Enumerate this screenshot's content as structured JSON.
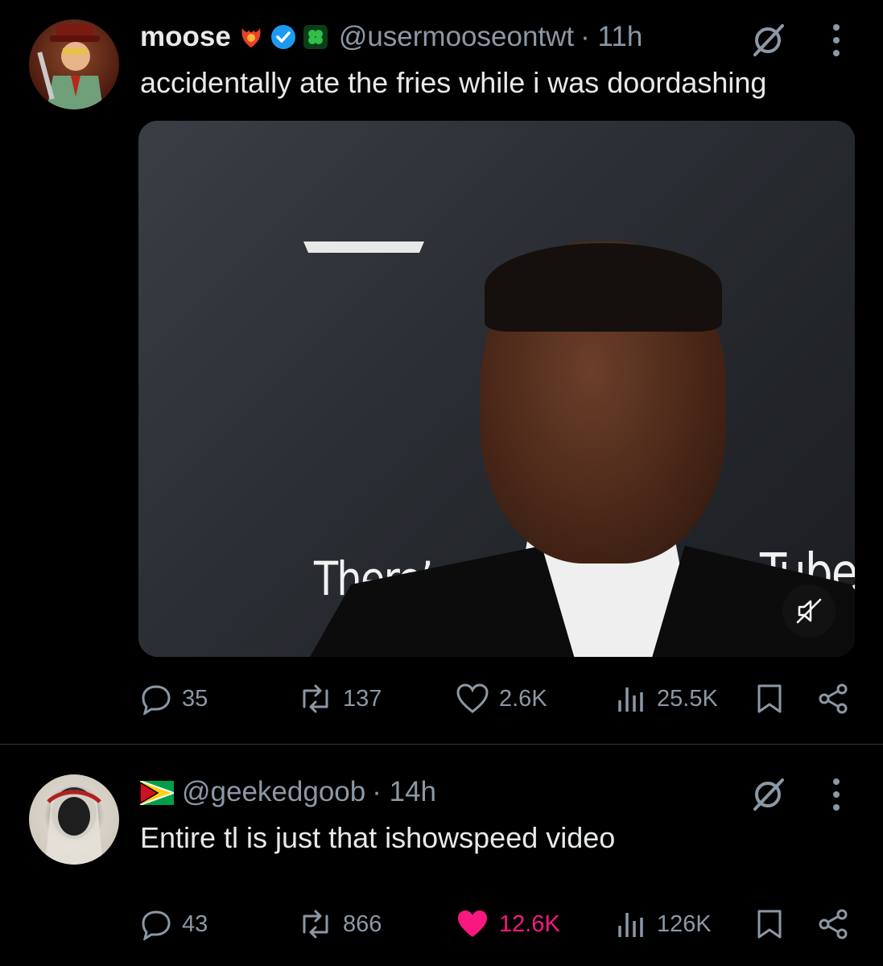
{
  "colors": {
    "background": "#000000",
    "text": "#e7e9ea",
    "muted": "#8b98a5",
    "verified": "#1d9bf0",
    "liked": "#f91880"
  },
  "post1": {
    "name": "moose",
    "handle": "@usermooseontwt",
    "time": "· 11h",
    "text": "accidentally ate the fries while i was doordashing",
    "media": {
      "sign_left": "There’s onl",
      "sign_right": "Tube"
    },
    "actions": {
      "replies": "35",
      "reposts": "137",
      "likes": "2.6K",
      "views": "25.5K"
    }
  },
  "post2": {
    "handle": "@geekedgoob",
    "time": "· 14h",
    "text": "Entire tl is just that ishowspeed video",
    "actions": {
      "replies": "43",
      "reposts": "866",
      "likes": "12.6K",
      "views": "126K"
    }
  }
}
